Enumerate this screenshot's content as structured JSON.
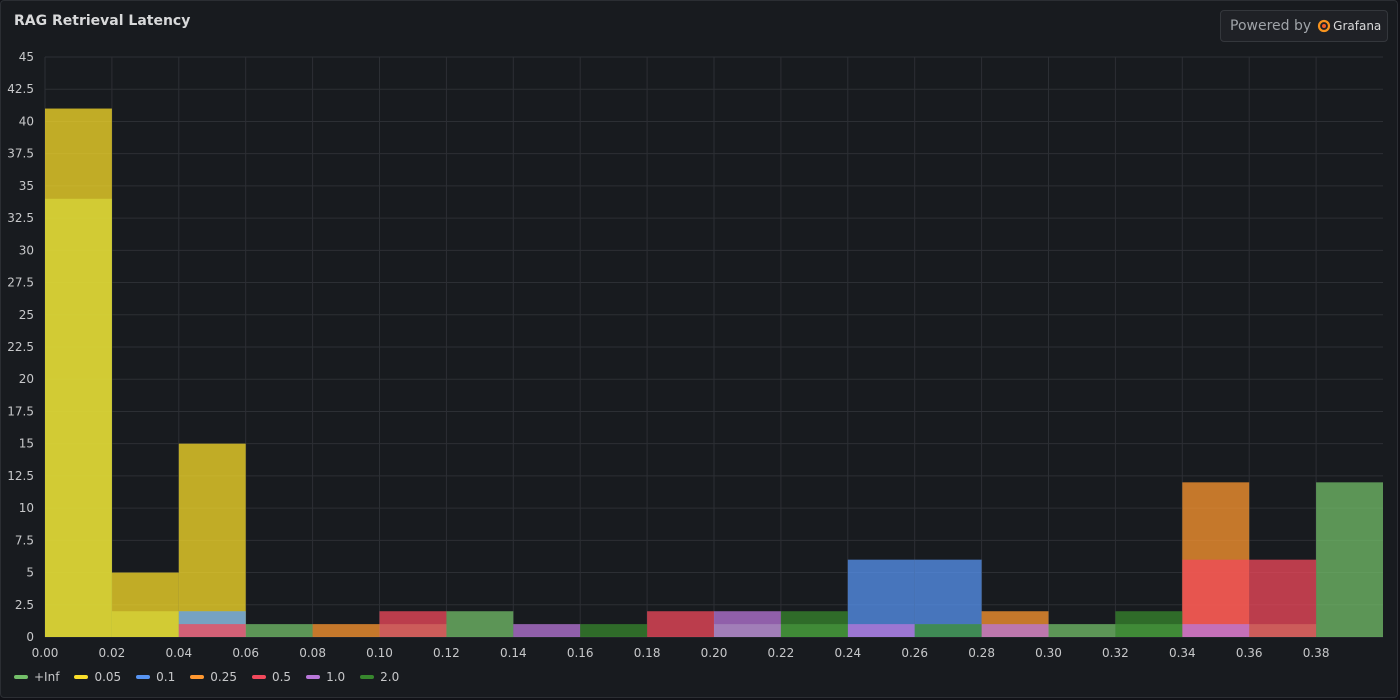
{
  "panel": {
    "title": "RAG Retrieval Latency",
    "powered_by": "Powered by",
    "brand": "Grafana"
  },
  "chart_data": {
    "type": "bar",
    "title": "RAG Retrieval Latency",
    "xlabel": "",
    "ylabel": "",
    "xlim": [
      0,
      0.4
    ],
    "ylim": [
      0,
      45
    ],
    "bin_width": 0.02,
    "x_ticks": [
      "0.00",
      "0.02",
      "0.04",
      "0.06",
      "0.08",
      "0.10",
      "0.12",
      "0.14",
      "0.16",
      "0.18",
      "0.20",
      "0.22",
      "0.24",
      "0.26",
      "0.28",
      "0.30",
      "0.32",
      "0.34",
      "0.36",
      "0.38"
    ],
    "y_ticks": [
      "0",
      "2.5",
      "5",
      "7.5",
      "10",
      "12.5",
      "15",
      "17.5",
      "20",
      "22.5",
      "25",
      "27.5",
      "30",
      "32.5",
      "35",
      "37.5",
      "40",
      "42.5",
      "45"
    ],
    "grid": true,
    "legend_position": "bottom-left",
    "series": [
      {
        "name": "+Inf",
        "color": "#73bf69",
        "values": [
          34,
          2,
          2,
          1,
          0,
          1,
          2,
          0,
          0,
          0,
          1,
          1,
          0,
          1,
          0,
          1,
          1,
          1,
          1,
          12
        ]
      },
      {
        "name": "0.05",
        "color": "#fade2a",
        "values": [
          41,
          5,
          15,
          0,
          0,
          0,
          0,
          0,
          0,
          0,
          0,
          0,
          0,
          0,
          0,
          0,
          0,
          0,
          0,
          0
        ]
      },
      {
        "name": "0.1",
        "color": "#5794f2",
        "values": [
          0,
          0,
          2,
          0,
          0,
          0,
          0,
          0,
          0,
          0,
          0,
          0,
          6,
          6,
          0,
          0,
          0,
          0,
          0,
          0
        ]
      },
      {
        "name": "0.25",
        "color": "#ff9830",
        "values": [
          0,
          0,
          0,
          0,
          1,
          0,
          0,
          0,
          0,
          0,
          0,
          0,
          0,
          0,
          2,
          0,
          0,
          12,
          0,
          0
        ]
      },
      {
        "name": "0.5",
        "color": "#f2495c",
        "values": [
          0,
          0,
          1,
          0,
          0,
          2,
          0,
          0,
          0,
          2,
          0,
          0,
          0,
          0,
          0,
          0,
          0,
          6,
          6,
          0
        ]
      },
      {
        "name": "1.0",
        "color": "#b877d9",
        "values": [
          0,
          0,
          0,
          0,
          0,
          0,
          0,
          1,
          0,
          0,
          2,
          0,
          1,
          0,
          1,
          0,
          0,
          1,
          0,
          0
        ]
      },
      {
        "name": "2.0",
        "color": "#37872d",
        "values": [
          0,
          0,
          0,
          0,
          0,
          0,
          0,
          0,
          1,
          0,
          0,
          2,
          0,
          1,
          0,
          0,
          2,
          0,
          0,
          0
        ]
      }
    ]
  }
}
